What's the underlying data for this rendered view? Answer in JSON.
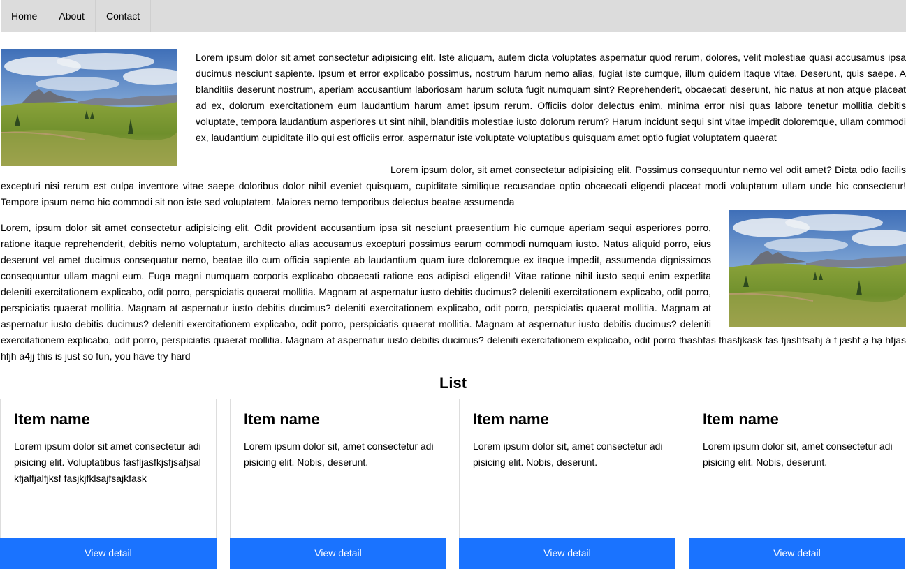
{
  "nav": {
    "items": [
      {
        "label": "Home"
      },
      {
        "label": "About"
      },
      {
        "label": "Contact"
      }
    ]
  },
  "article": {
    "paragraph1": "Lorem ipsum dolor sit amet consectetur adipisicing elit. Iste aliquam, autem dicta voluptates aspernatur quod rerum, dolores, velit molestiae quasi accusamus ipsa ducimus nesciunt sapiente. Ipsum et error explicabo possimus, nostrum harum nemo alias, fugiat iste cumque, illum quidem itaque vitae. Deserunt, quis saepe. A blanditiis deserunt nostrum, aperiam accusantium laboriosam harum soluta fugit numquam sint? Reprehenderit, obcaecati deserunt, hic natus at non atque placeat ad ex, dolorum exercitationem eum laudantium harum amet ipsum rerum. Officiis dolor delectus enim, minima error nisi quas labore tenetur mollitia debitis voluptate, tempora laudantium asperiores ut sint nihil, blanditiis molestiae iusto dolorum rerum? Harum incidunt sequi sint vitae impedit doloremque, ullam commodi ex, laudantium cupiditate illo qui est officiis error, aspernatur iste voluptate voluptatibus quisquam amet optio fugiat voluptatem quaerat",
    "paragraph2": "Lorem ipsum dolor, sit amet consectetur adipisicing elit. Possimus consequuntur nemo vel odit amet? Dicta odio facilis excepturi nisi rerum est culpa inventore vitae saepe doloribus dolor nihil eveniet quisquam, cupiditate similique recusandae optio obcaecati eligendi placeat modi voluptatum ullam unde hic consectetur! Tempore ipsum nemo hic commodi sit non iste sed voluptatem. Maiores nemo temporibus delectus beatae assumenda",
    "paragraph3": "Lorem, ipsum dolor sit amet consectetur adipisicing elit. Odit provident accusantium ipsa sit nesciunt praesentium hic cumque aperiam sequi asperiores porro, ratione itaque reprehenderit, debitis nemo voluptatum, architecto alias accusamus excepturi possimus earum commodi numquam iusto. Natus aliquid porro, eius deserunt vel amet ducimus consequatur nemo, beatae illo cum officia sapiente ab laudantium quam iure doloremque ex itaque impedit, assumenda dignissimos consequuntur ullam magni eum. Fuga magni numquam corporis explicabo obcaecati ratione eos adipisci eligendi! Vitae ratione nihil iusto sequi enim expedita deleniti exercitationem explicabo, odit porro, perspiciatis quaerat mollitia. Magnam at aspernatur iusto debitis ducimus? deleniti exercitationem explicabo, odit porro, perspiciatis quaerat mollitia. Magnam at aspernatur iusto debitis ducimus? deleniti exercitationem explicabo, odit porro, perspiciatis quaerat mollitia. Magnam at aspernatur iusto debitis ducimus? deleniti exercitationem explicabo, odit porro, perspiciatis quaerat mollitia. Magnam at aspernatur iusto debitis ducimus? deleniti exercitationem explicabo, odit porro, perspiciatis quaerat mollitia. Magnam at aspernatur iusto debitis ducimus? deleniti exercitationem explicabo, odit porro fhashfas fhasfjkask fas fjashfsahj á f jashf ạ hạ hfjas hfjh a4jj this is just so fun, you have try hard"
  },
  "list": {
    "title": "List",
    "items": [
      {
        "name": "Item name",
        "description": "Lorem ipsum dolor sit amet consectetur adipisicing elit. Voluptatibus fasfljasfkjsfjsafjsalkfjalfjalfjksf fasjkjfklsajfsajkfask",
        "button": "View detail"
      },
      {
        "name": "Item name",
        "description": "Lorem ipsum dolor sit, amet consectetur adipisicing elit. Nobis, deserunt.",
        "button": "View detail"
      },
      {
        "name": "Item name",
        "description": "Lorem ipsum dolor sit, amet consectetur adipisicing elit. Nobis, deserunt.",
        "button": "View detail"
      },
      {
        "name": "Item name",
        "description": "Lorem ipsum dolor sit, amet consectetur adipisicing elit. Nobis, deserunt.",
        "button": "View detail"
      }
    ]
  },
  "colors": {
    "nav_background": "#dcdcdc",
    "button_background": "#1a73ff",
    "button_text": "#ffffff",
    "card_border": "#dddddd"
  },
  "images": [
    {
      "icon": "landscape-image",
      "alt": ""
    },
    {
      "icon": "landscape-image",
      "alt": ""
    }
  ]
}
